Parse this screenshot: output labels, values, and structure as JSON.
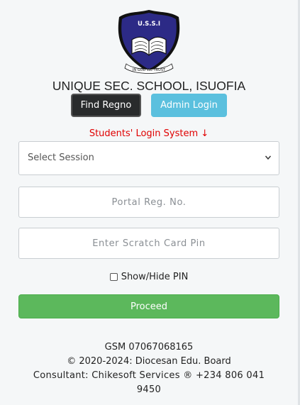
{
  "logo": {
    "badge_text": "U.S.S.I",
    "motto": "IN GOD WE TRUST",
    "colors": {
      "shield": "#2c2a86",
      "shield_outline": "#111111",
      "book": "#ffffff"
    }
  },
  "header": {
    "school_name": "UNIQUE SEC. SCHOOL, ISUOFIA"
  },
  "buttons": {
    "find_regno": "Find Regno",
    "admin_login": "Admin Login",
    "proceed": "Proceed"
  },
  "login": {
    "title": "Students' Login System ↓",
    "session_select": {
      "selected": "Select Session",
      "icon": "chevron-down-icon"
    },
    "regno_field": {
      "value": "",
      "placeholder": "Portal Reg. No."
    },
    "pin_field": {
      "value": "",
      "placeholder": "Enter Scratch Card Pin"
    },
    "show_hide_pin": {
      "label": "Show/Hide PIN",
      "checked": false
    }
  },
  "footer": {
    "gsm": "GSM 07067068165",
    "copyright": "© 2020-2024: Diocesan Edu. Board",
    "consultant": "Consultant: Chikesoft Services ® +234 806 041 9450"
  },
  "colors": {
    "title_red": "#e00000",
    "dark_button": "#292b2c",
    "info_button": "#5bc0de",
    "success_button": "#5cb85c",
    "background": "#f5f7f8"
  }
}
